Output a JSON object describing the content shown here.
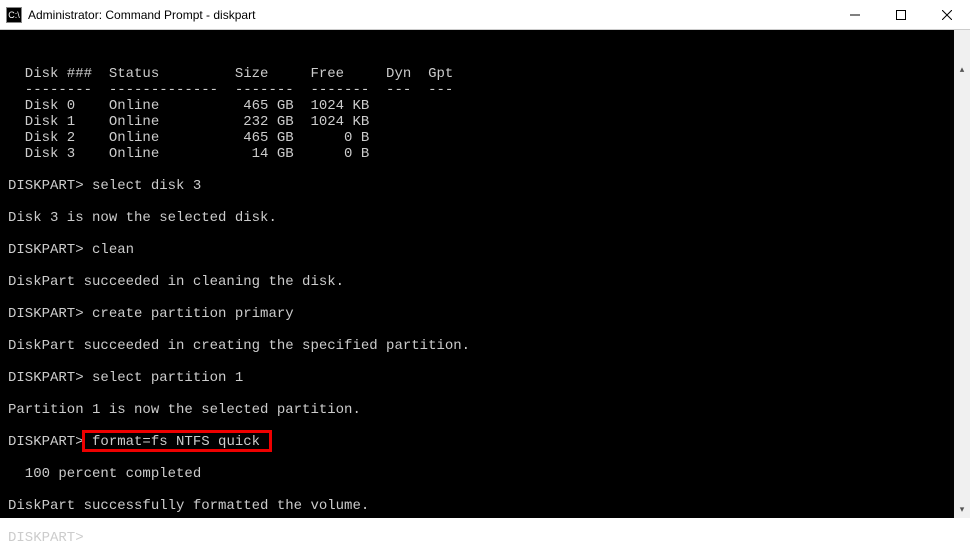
{
  "window": {
    "title": "Administrator: Command Prompt - diskpart",
    "icon_text": "C:\\"
  },
  "terminal": {
    "header_line": "  Disk ###  Status         Size     Free     Dyn  Gpt",
    "divider_line": "  --------  -------------  -------  -------  ---  ---",
    "disks": [
      "  Disk 0    Online          465 GB  1024 KB",
      "  Disk 1    Online          232 GB  1024 KB",
      "  Disk 2    Online          465 GB      0 B",
      "  Disk 3    Online           14 GB      0 B"
    ],
    "lines": [
      {
        "prompt": "DISKPART> ",
        "cmd": "select disk 3"
      },
      {
        "text": "Disk 3 is now the selected disk."
      },
      {
        "prompt": "DISKPART> ",
        "cmd": "clean"
      },
      {
        "text": "DiskPart succeeded in cleaning the disk."
      },
      {
        "prompt": "DISKPART> ",
        "cmd": "create partition primary"
      },
      {
        "text": "DiskPart succeeded in creating the specified partition."
      },
      {
        "prompt": "DISKPART> ",
        "cmd": "select partition 1"
      },
      {
        "text": "Partition 1 is now the selected partition."
      },
      {
        "prompt": "DISKPART> ",
        "cmd": "format=fs NTFS quick",
        "highlight": true
      },
      {
        "text": "  100 percent completed"
      },
      {
        "text": "DiskPart successfully formatted the volume."
      },
      {
        "prompt": "DISKPART>",
        "cmd": ""
      }
    ]
  }
}
